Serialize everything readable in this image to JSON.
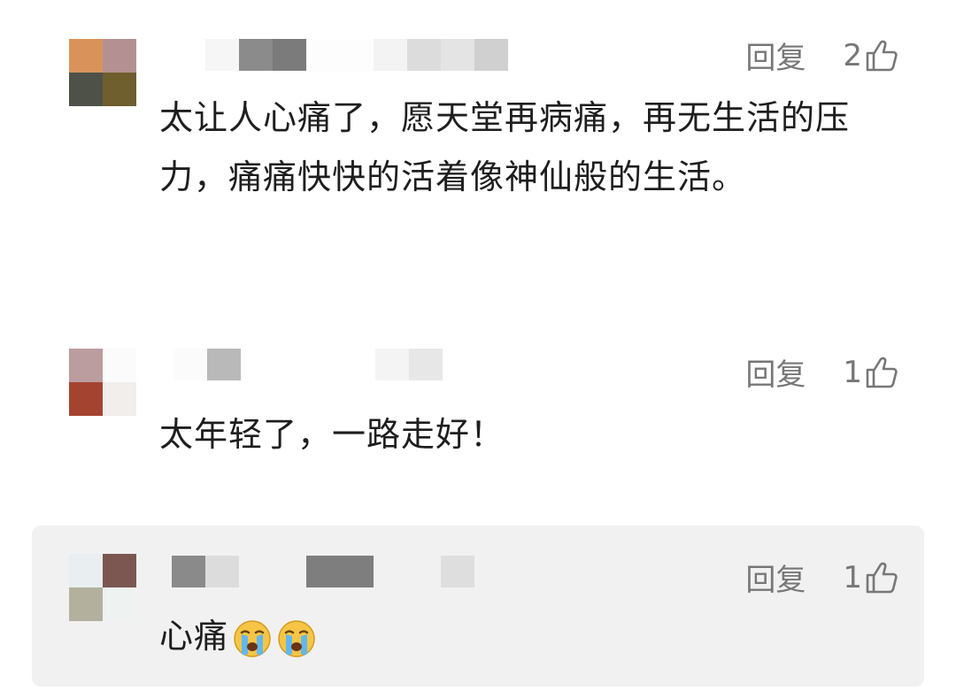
{
  "comments": [
    {
      "text": "太让人心痛了，愿天堂再病痛，再无生活的压力，痛痛快快的活着像神仙般的生活。",
      "reply_label": "回复",
      "likes": "2",
      "avatar_colors": [
        "#d9935a",
        "#b49092",
        "#4e5148",
        "#6f5e2e"
      ]
    },
    {
      "text": "太年轻了，一路走好！",
      "reply_label": "回复",
      "likes": "1",
      "avatar_colors": [
        "#bb9c9f",
        "#fbfbfb",
        "#a34330",
        "#f1eeec"
      ]
    },
    {
      "text": "心痛",
      "emojis": [
        "loudly-crying-face",
        "loudly-crying-face"
      ],
      "reply_label": "回复",
      "likes": "1",
      "avatar_colors": [
        "#e9eff0",
        "#7c5752",
        "#b3b19e",
        "#eef2f1"
      ]
    }
  ],
  "colors": {
    "meta_text": "#777777",
    "body_text": "#1e1e1e",
    "highlight_bg": "#f1f1f1"
  }
}
